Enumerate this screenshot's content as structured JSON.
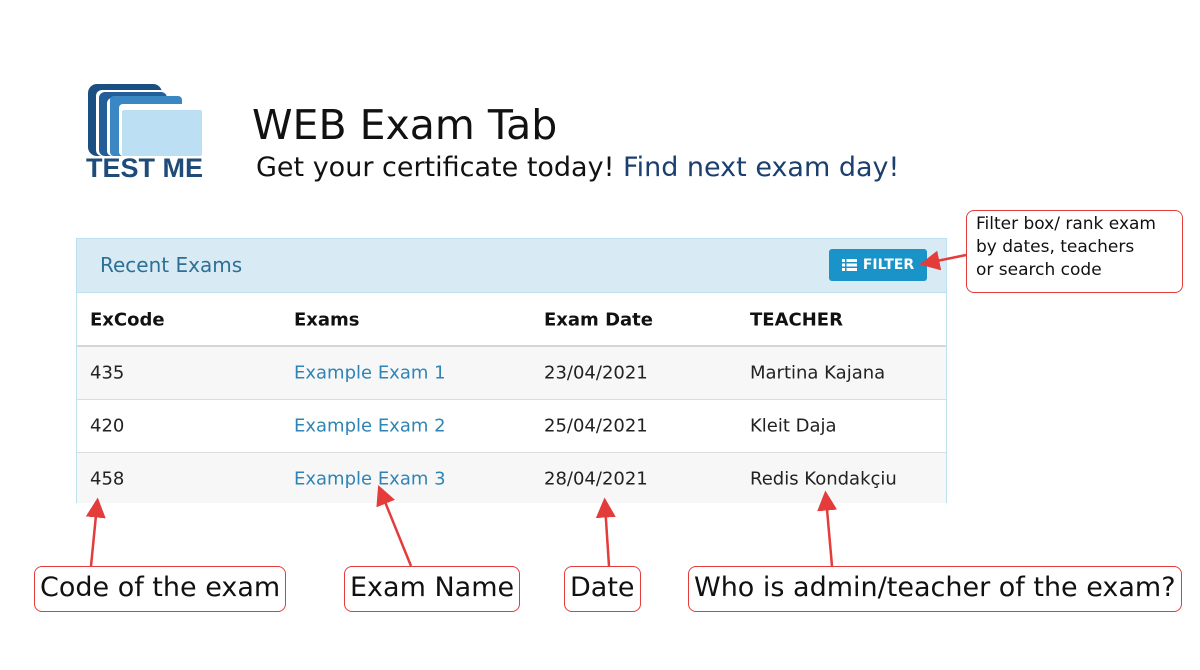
{
  "header": {
    "logo_text": "TEST ME",
    "title": "WEB Exam Tab",
    "tagline_text": "Get your certificate today!",
    "tagline_link": "Find next exam day!"
  },
  "panel": {
    "title": "Recent Exams",
    "filter_label": "FILTER",
    "columns": [
      "ExCode",
      "Exams",
      "Exam Date",
      "TEACHER"
    ],
    "rows": [
      {
        "code": "435",
        "exam": "Example Exam 1",
        "date": "23/04/2021",
        "teacher": "Martina Kajana"
      },
      {
        "code": "420",
        "exam": "Example Exam 2",
        "date": "25/04/2021",
        "teacher": "Kleit Daja"
      },
      {
        "code": "458",
        "exam": "Example Exam 3",
        "date": "28/04/2021",
        "teacher": "Redis Kondakçiu"
      }
    ]
  },
  "annotations": {
    "filter_note_line1": "Filter box/ rank exam",
    "filter_note_line2": "by dates, teachers",
    "filter_note_line3": "or search code",
    "code_note": "Code of the exam",
    "name_note": "Exam Name",
    "date_note": "Date",
    "teacher_note": "Who is admin/teacher of the exam?"
  },
  "colors": {
    "header_bg": "#d8ebf4",
    "accent": "#1a93c9",
    "link": "#2f84b6",
    "annotation": "#e43b3b",
    "logo": "#1f4b79"
  }
}
